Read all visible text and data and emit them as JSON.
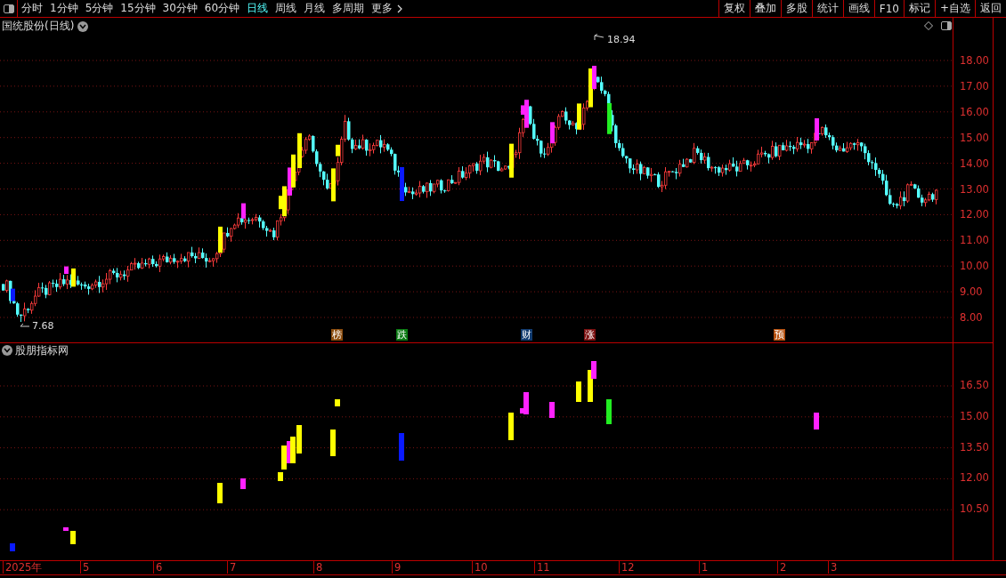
{
  "toolbar": {
    "periods": [
      {
        "label": "分时",
        "selected": false
      },
      {
        "label": "1分钟",
        "selected": false
      },
      {
        "label": "5分钟",
        "selected": false
      },
      {
        "label": "15分钟",
        "selected": false
      },
      {
        "label": "30分钟",
        "selected": false
      },
      {
        "label": "60分钟",
        "selected": false
      },
      {
        "label": "日线",
        "selected": true
      },
      {
        "label": "周线",
        "selected": false
      },
      {
        "label": "月线",
        "selected": false
      },
      {
        "label": "多周期",
        "selected": false
      }
    ],
    "more": "更多",
    "actions": [
      "复权",
      "叠加",
      "多股",
      "统计",
      "画线",
      "F10",
      "标记",
      "+自选",
      "返回"
    ]
  },
  "main_chart": {
    "title": "国统股份(日线)",
    "price_axis": [
      "18.00",
      "17.00",
      "16.00",
      "15.00",
      "14.00",
      "13.00",
      "12.00",
      "11.00",
      "10.00",
      "9.00",
      "8.00"
    ],
    "high_label": "18.94",
    "low_label": "7.68",
    "event_tags": [
      {
        "label": "榜",
        "color": "#8a4b0c"
      },
      {
        "label": "跌",
        "color": "#0a7a12"
      },
      {
        "label": "财",
        "color": "#103a6e"
      },
      {
        "label": "涨",
        "color": "#7a1010"
      },
      {
        "label": "预",
        "color": "#b5500e"
      }
    ]
  },
  "indicator": {
    "title": "股朋指标网",
    "axis": [
      "16.50",
      "15.00",
      "13.50",
      "12.00",
      "10.50"
    ]
  },
  "time_axis": [
    "2025年",
    "5",
    "6",
    "7",
    "8",
    "9",
    "10",
    "11",
    "12",
    "1",
    "2",
    "3"
  ]
}
